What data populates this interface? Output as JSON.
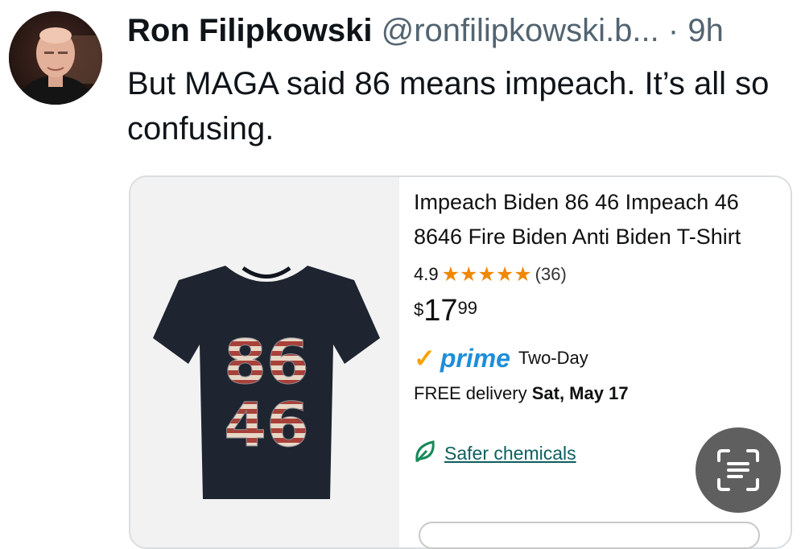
{
  "tweet": {
    "author": "Ron Filipkowski",
    "handle": "@ronfilipkowski.b...",
    "separator": "·",
    "time": "9h",
    "text": "But MAGA said 86 means impeach. It’s all so confusing."
  },
  "product": {
    "title": "Impeach Biden 86 46 Impeach 46 8646 Fire Biden Anti Biden T-Shirt",
    "rating": "4.9",
    "stars": "★★★★★",
    "review_count": "(36)",
    "price": {
      "currency": "$",
      "whole": "17",
      "cents": "99"
    },
    "prime_check": "✓",
    "prime_label": "prime",
    "shipping": "Two-Day",
    "delivery_prefix": "FREE delivery",
    "delivery_date": "Sat, May 17",
    "safer_chemicals": "Safer chemicals",
    "shirt_print": [
      "86",
      "46"
    ]
  },
  "icons": {
    "lens": "text-scan-icon",
    "leaf": "leaf-icon"
  },
  "colors": {
    "star": "#f08804",
    "prime_blue": "#1f8ed6",
    "prime_check": "#f7a200",
    "link_teal": "#0f5e5e"
  }
}
